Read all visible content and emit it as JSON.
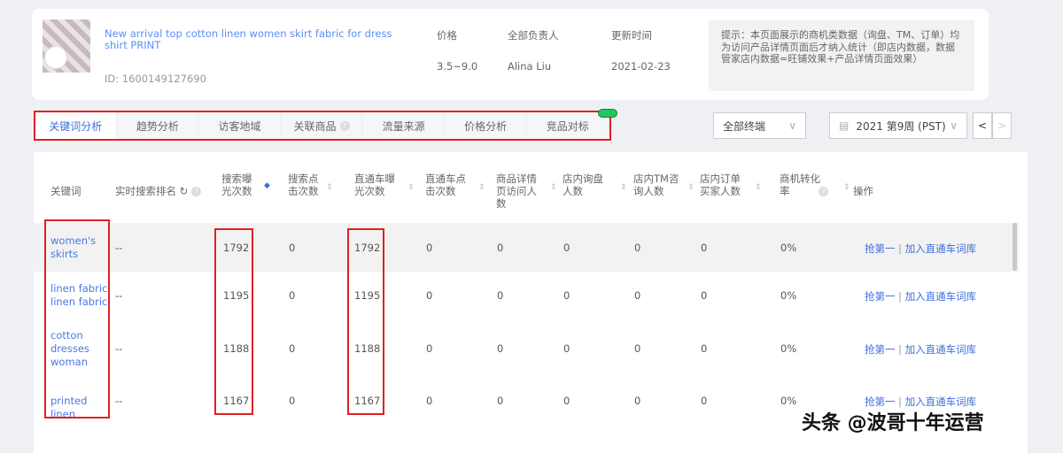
{
  "product": {
    "title": "New arrival top cotton linen women skirt fabric for dress shirt PRINT",
    "id": "ID: 1600149127690",
    "price_label": "价格",
    "price": "3.5~9.0",
    "owner_label": "全部负责人",
    "owner": "Alina Liu",
    "updated_label": "更新时间",
    "updated": "2021-02-23"
  },
  "tip": "提示：本页面展示的商机类数据（询盘、TM、订单）均为访问产品详情页面后才纳入统计（即店内数据，数据管家店内数据=旺铺效果+产品详情页面效果）",
  "tabs": [
    "关键词分析",
    "趋势分析",
    "访客地域",
    "关联商品",
    "流量来源",
    "价格分析",
    "竞品对标"
  ],
  "terminal_select": "全部终端",
  "week_select": "2021 第9周 (PST)",
  "columns": [
    "关键词",
    "实时搜索排名",
    "搜索曝光次数",
    "搜索点击次数",
    "直通车曝光次数",
    "直通车点击次数",
    "商品详情页访问人数",
    "店内询盘人数",
    "店内TM咨询人数",
    "店内订单买家人数",
    "商机转化率",
    "操作"
  ],
  "rows": [
    {
      "keyword": "women's skirts",
      "rank": "--",
      "search_exp": "1792",
      "search_click": "0",
      "p4p_exp": "1792",
      "p4p_click": "0",
      "detail": "0",
      "inquiry": "0",
      "tm": "0",
      "order": "0",
      "rate": "0%"
    },
    {
      "keyword": "linen fabric linen fabric",
      "rank": "--",
      "search_exp": "1195",
      "search_click": "0",
      "p4p_exp": "1195",
      "p4p_click": "0",
      "detail": "0",
      "inquiry": "0",
      "tm": "0",
      "order": "0",
      "rate": "0%"
    },
    {
      "keyword": "cotton dresses woman",
      "rank": "--",
      "search_exp": "1188",
      "search_click": "0",
      "p4p_exp": "1188",
      "p4p_click": "0",
      "detail": "0",
      "inquiry": "0",
      "tm": "0",
      "order": "0",
      "rate": "0%"
    },
    {
      "keyword": "printed linen",
      "rank": "--",
      "search_exp": "1167",
      "search_click": "0",
      "p4p_exp": "1167",
      "p4p_click": "0",
      "detail": "0",
      "inquiry": "0",
      "tm": "0",
      "order": "0",
      "rate": "0%"
    }
  ],
  "actions": {
    "first": "抢第一",
    "sep": "|",
    "add": "加入直通车词库"
  },
  "watermark": "头条 @波哥十年运营"
}
